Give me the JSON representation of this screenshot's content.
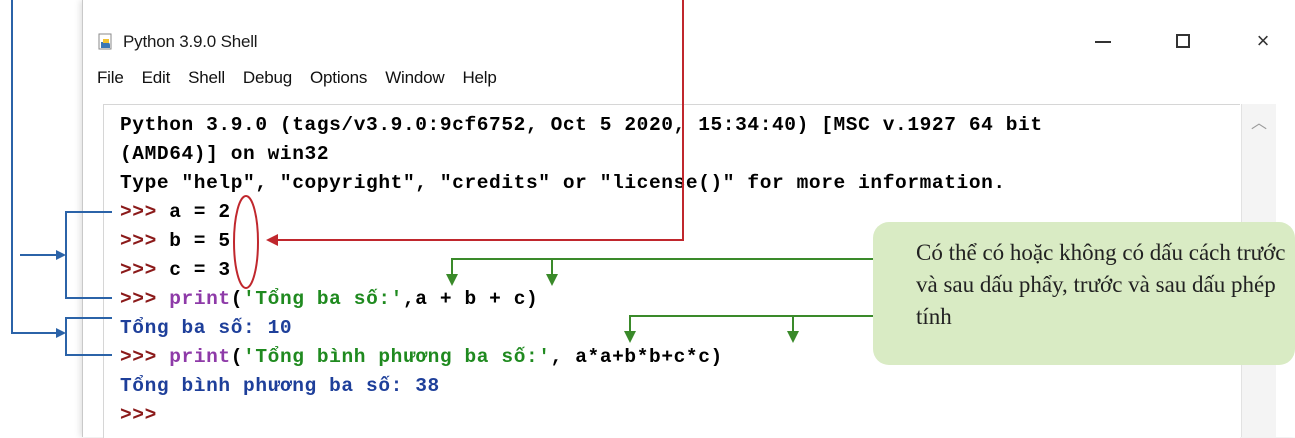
{
  "window": {
    "title": "Python 3.9.0 Shell",
    "icon": "python-idle-icon",
    "controls": [
      "minimize-icon",
      "maximize-icon",
      "close-icon"
    ],
    "close_glyph": "×"
  },
  "menu": [
    "File",
    "Edit",
    "Shell",
    "Debug",
    "Options",
    "Window",
    "Help"
  ],
  "shell": {
    "banner1": "Python 3.9.0 (tags/v3.9.0:9cf6752, Oct 5 2020, 15:34:40) [MSC v.1927 64 bit",
    "banner2": "(AMD64)] on win32",
    "banner3": "Type \"help\", \"copyright\", \"credits\" or \"license()\" for more information.",
    "prompt": ">>>",
    "a_code": " a = 2",
    "b_code": " b = 5",
    "c_code": " c = 3",
    "print1_kw": "print",
    "print1_open": "(",
    "print1_str": "'Tổng ba số:'",
    "print1_rest": ",a + b + c)",
    "output1": "Tổng ba số: 10",
    "print2_kw": "print",
    "print2_open": "(",
    "print2_str": "'Tổng bình phương ba số:'",
    "print2_rest": ", a*a+b*b+c*c)",
    "output2": "Tổng bình phương ba số: 38",
    "last_prompt": ">>>"
  },
  "annotation": {
    "callout_text": "Có thể có hoặc không có dấu cách trước và sau dấu phẩy, trước và sau dấu phép tính"
  },
  "colors": {
    "prompt": "#8b1a1a",
    "keyword": "#8e3aa8",
    "string": "#1f8a1f",
    "output": "#1e3f9a",
    "annotation_blue": "#2b63a8",
    "annotation_red": "#c0272d",
    "annotation_green": "#3a8a2a",
    "callout_bg": "#d9ebc4"
  }
}
